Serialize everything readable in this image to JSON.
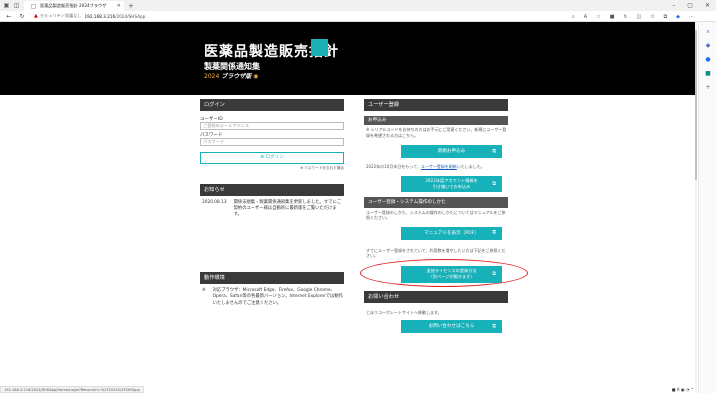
{
  "browser": {
    "tab_title": "医薬品製造販売指針 2024ブラウザ",
    "security_label": "セキュリティ保護なし",
    "url_host": "192.168.3.216",
    "url_path": "/2024/SHSApp"
  },
  "hero": {
    "title": "医薬品製造販売指針",
    "subtitle": "製薬関係通知集",
    "edition": "2024",
    "edition_label": "ブラウザ版"
  },
  "login": {
    "heading": "ログイン",
    "user_id_label": "ユーザーID",
    "user_id_placeholder": "ご登録のメールアドレス",
    "password_label": "パスワード",
    "password_placeholder": "パスワード",
    "login_button": "ログイン",
    "forgot_link": "パスワードを忘れた場合"
  },
  "news": {
    "heading": "お知らせ",
    "items": [
      {
        "date": "2020.08.13",
        "text": "関係法規集・製薬関係通知集を更新しました。すでにご契約のユーザー様は自動的に最新版をご覧いただけます。"
      }
    ]
  },
  "env": {
    "heading": "動作環境",
    "text": "対応ブラウザ：Microsoft Edge、Firefox、Google Chrome、Opera、Safari等の各最新バージョン。Internet Explorerでは動作いたしませんのでご注意ください。"
  },
  "register": {
    "heading": "ユーザー登録",
    "apply_heading": "お申込み",
    "apply_note": "※ シリアルコードをお持ちの方はお手元にご用意ください。新規にユーザー登録を希望される方はこちら。",
    "new_apply_button": "新規お申込み",
    "notice_prefix": "2022年の10月末日をもって、",
    "notice_link": "ユーザー登録を刷新",
    "notice_suffix": "いたしました。",
    "migrate_button_l1": "2022年度アカウント情報を",
    "migrate_button_l2": "引き継いでお申込み",
    "howto_heading": "ユーザー登録・システム操作のしかた",
    "howto_note": "ユーザー登録のしかた、システムの操作のしかたについてはマニュアルをご参照ください。",
    "manual_button": "マニュアルを表示（PDF）",
    "license_note": "すでにユーザー登録をされていて、利用数を増やしたい方は下記をご参照ください。",
    "license_button_l1": "追加ライセンスの登録方法",
    "license_button_l2": "（別ページが開きます）"
  },
  "contact": {
    "heading": "お問い合わせ",
    "note": "じほうコーポレートサイトへ移動します。",
    "button": "お問い合わせはこちら"
  },
  "status_url": "192.168.3.216/2024/SHSApp/Home/Login?ReturnUrl=%2F2024%2FSHSApp",
  "colors": {
    "teal": "#17b1b9",
    "dark": "#3a3a3a",
    "highlight": "#e02020"
  }
}
